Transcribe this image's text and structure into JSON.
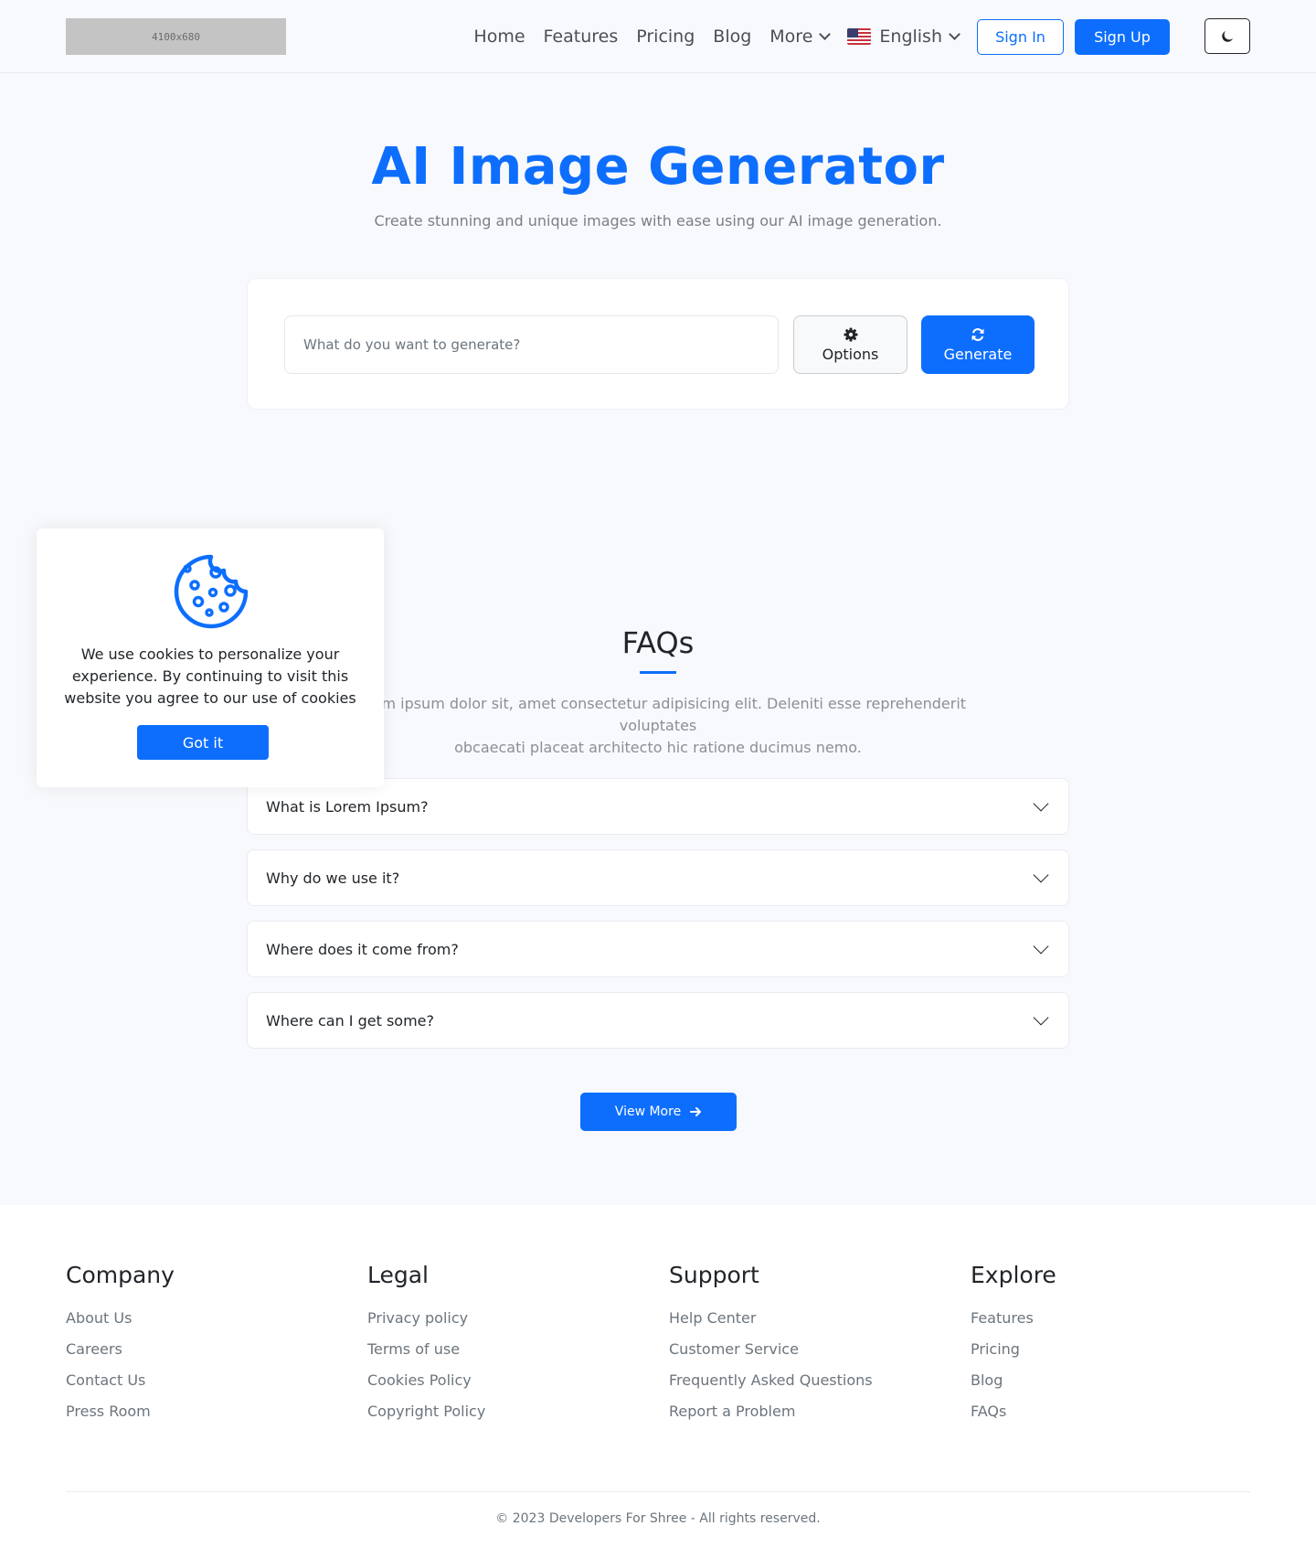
{
  "header": {
    "logo_text": "4100x680",
    "nav": [
      "Home",
      "Features",
      "Pricing",
      "Blog"
    ],
    "more_label": "More",
    "language_label": "English",
    "sign_in_label": "Sign In",
    "sign_up_label": "Sign Up"
  },
  "hero": {
    "title": "AI Image Generator",
    "subtitle": "Create stunning and unique images with ease using our AI image generation.",
    "prompt_placeholder": "What do you want to generate?",
    "prompt_value": "",
    "options_label": "Options",
    "generate_label": "Generate"
  },
  "faq": {
    "title": "FAQs",
    "description_line1": "Lorem ipsum dolor sit, amet consectetur adipisicing elit. Deleniti esse reprehenderit voluptates",
    "description_line2": "obcaecati placeat architecto hic ratione ducimus nemo.",
    "items": [
      "What is Lorem Ipsum?",
      "Why do we use it?",
      "Where does it come from?",
      "Where can I get some?"
    ],
    "view_more_label": "View More"
  },
  "cookie": {
    "message": "We use cookies to personalize your experience. By continuing to visit this website you agree to our use of cookies",
    "button_label": "Got it"
  },
  "footer": {
    "columns": [
      {
        "title": "Company",
        "links": [
          "About Us",
          "Careers",
          "Contact Us",
          "Press Room"
        ]
      },
      {
        "title": "Legal",
        "links": [
          "Privacy policy",
          "Terms of use",
          "Cookies Policy",
          "Copyright Policy"
        ]
      },
      {
        "title": "Support",
        "links": [
          "Help Center",
          "Customer Service",
          "Frequently Asked Questions",
          "Report a Problem"
        ]
      },
      {
        "title": "Explore",
        "links": [
          "Features",
          "Pricing",
          "Blog",
          "FAQs"
        ]
      }
    ],
    "copyright": "© 2023 Developers For Shree - All rights reserved."
  },
  "colors": {
    "primary": "#0d6efd",
    "background": "#f8f9fc",
    "text": "#212529",
    "muted": "#6c757d"
  },
  "icons": [
    "us-flag-icon",
    "chevron-down-icon",
    "moon-icon",
    "gear-icon",
    "refresh-icon",
    "cookie-icon",
    "arrow-right-icon"
  ]
}
